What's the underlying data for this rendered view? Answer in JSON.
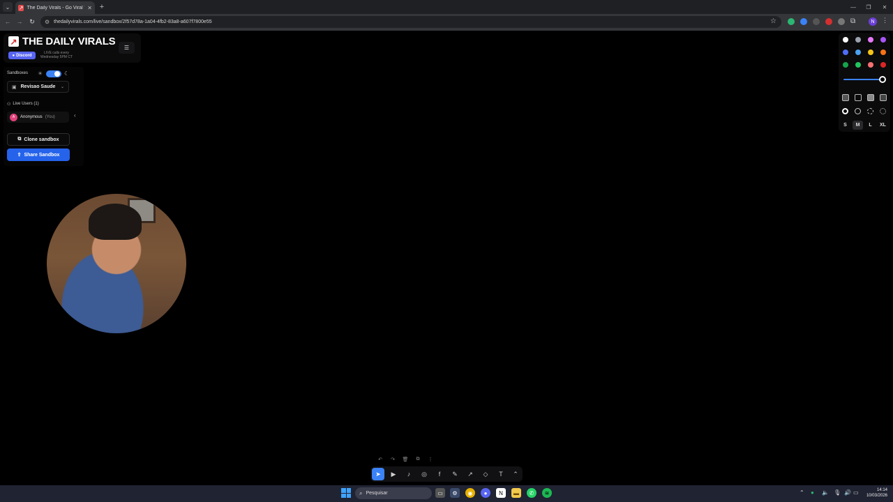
{
  "browser": {
    "tab_title": "The Daily Virals - Go Viral Today",
    "url": "thedailyvirals.com/live/sandbox/2f57d78a-1a04-4fb2-83a8-a607f7800e55",
    "profile_initial": "N"
  },
  "brand": {
    "title": "THE DAILY VIRALS",
    "discord_label": "Discord",
    "live_calls": "LIVE calls every Wednesday 5PM CT"
  },
  "sidebar": {
    "sandboxes_label": "Sandboxes",
    "selected_sandbox": "Revisao Saude",
    "live_users_label": "Live Users (1)",
    "users": [
      {
        "initial": "A",
        "name": "Anonymous",
        "suffix": "(You)"
      }
    ],
    "clone_label": "Clone sandbox",
    "share_label": "Share Sandbox",
    "dark_mode": true
  },
  "style_panel": {
    "colors": [
      "#ffffff",
      "#9ca3af",
      "#e879f9",
      "#a855f7",
      "#4f6ef7",
      "#4aa3f0",
      "#f5c518",
      "#f97316",
      "#16a34a",
      "#22c55e",
      "#f87171",
      "#dc2626"
    ],
    "opacity": 1.0,
    "sizes": [
      "S",
      "M",
      "L",
      "XL"
    ],
    "active_size": "M"
  },
  "taskbar": {
    "search_placeholder": "Pesquisar",
    "time": "14:14",
    "date": "10/03/2026"
  }
}
